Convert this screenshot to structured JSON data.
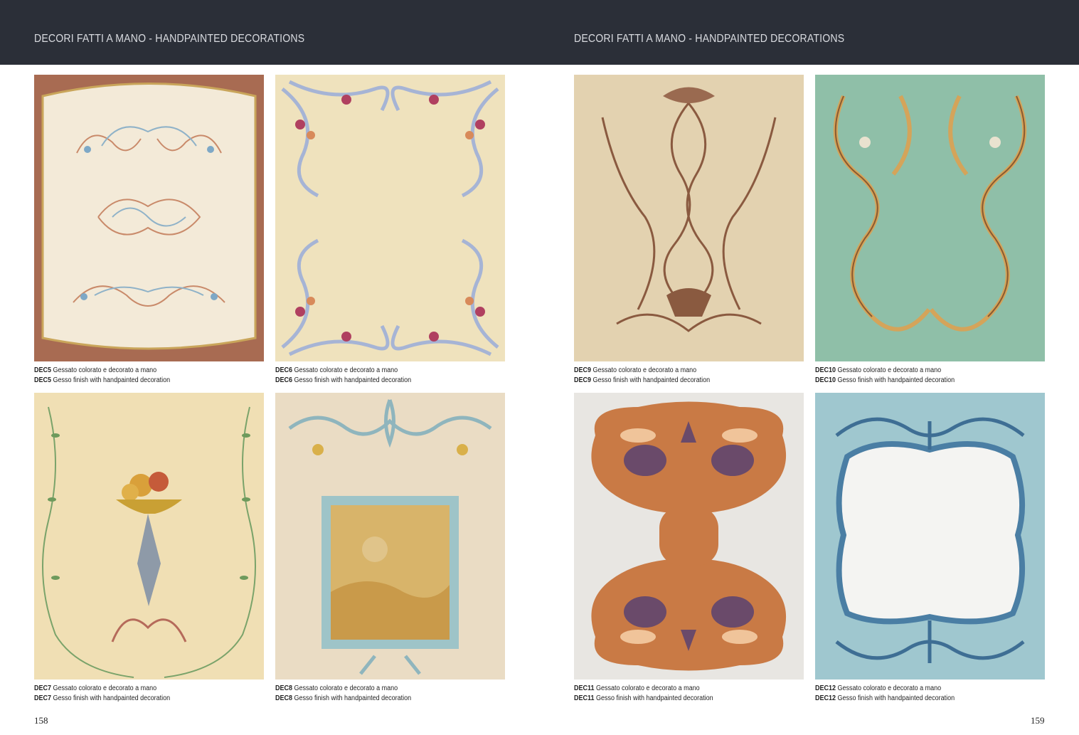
{
  "header": {
    "left_title": "DECORI FATTI A MANO - HANDPAINTED DECORATIONS",
    "right_title": "DECORI FATTI A MANO - HANDPAINTED DECORATIONS"
  },
  "page_numbers": {
    "left": "158",
    "right": "159"
  },
  "items": [
    {
      "code": "DEC5",
      "it": "Gessato colorato e decorato a mano",
      "en": "Gesso finish with handpainted decoration"
    },
    {
      "code": "DEC6",
      "it": "Gessato colorato e decorato a mano",
      "en": "Gesso finish with handpainted decoration"
    },
    {
      "code": "DEC9",
      "it": "Gessato colorato e decorato a mano",
      "en": "Gesso finish with handpainted decoration"
    },
    {
      "code": "DEC10",
      "it": "Gessato colorato e decorato a mano",
      "en": "Gesso finish with handpainted decoration"
    },
    {
      "code": "DEC7",
      "it": "Gessato colorato e decorato a mano",
      "en": "Gesso finish with handpainted decoration"
    },
    {
      "code": "DEC8",
      "it": "Gessato colorato e decorato a mano",
      "en": "Gesso finish with handpainted decoration"
    },
    {
      "code": "DEC11",
      "it": "Gessato colorato e decorato a mano",
      "en": "Gesso finish with handpainted decoration"
    },
    {
      "code": "DEC12",
      "it": "Gessato colorato e decorato a mano",
      "en": "Gesso finish with handpainted decoration"
    }
  ],
  "colors": {
    "header_bg": "#2b2f38",
    "header_text": "#d9dbe0",
    "page_bg": "#ffffff"
  }
}
